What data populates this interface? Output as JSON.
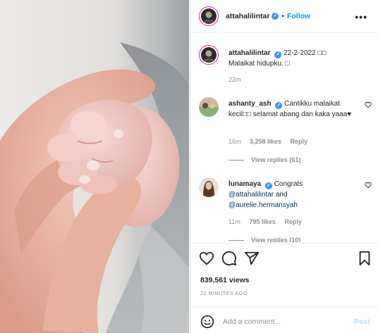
{
  "post": {
    "username": "attahalilintar",
    "follow_label": "Follow",
    "more_label": "•••",
    "caption": {
      "username": "attahalilintar",
      "text": "22-2-2022 □□",
      "text2": "Malaikat hidupku. □",
      "time": "22m"
    },
    "comments": [
      {
        "username": "ashanty_ash",
        "text": "Cantikku malaikat kecil□□ selamat abang dan kaka yaaa♥",
        "time": "16m",
        "likes": "3,258 likes",
        "reply": "Reply",
        "view_replies": "View replies (61)"
      },
      {
        "username": "lunamaya",
        "text": "Congrats",
        "mention1": "@attahalilintar",
        "and_text": "and",
        "mention2": "@aurelie.hermansyah",
        "time": "11m",
        "likes": "795 likes",
        "reply": "Reply",
        "view_replies": "View replies (10)"
      }
    ],
    "views": "839,561 views",
    "ago": "22 MINUTES AGO",
    "add_comment_placeholder": "Add a comment...",
    "post_label": "Post"
  },
  "colors": {
    "accent": "#0095f6",
    "verified": "#3897f0",
    "muted": "#8e8e8e"
  },
  "icons": [
    "verified-badge-icon",
    "more-icon",
    "heart-icon",
    "comment-icon",
    "share-icon",
    "bookmark-icon",
    "emoji-icon"
  ]
}
